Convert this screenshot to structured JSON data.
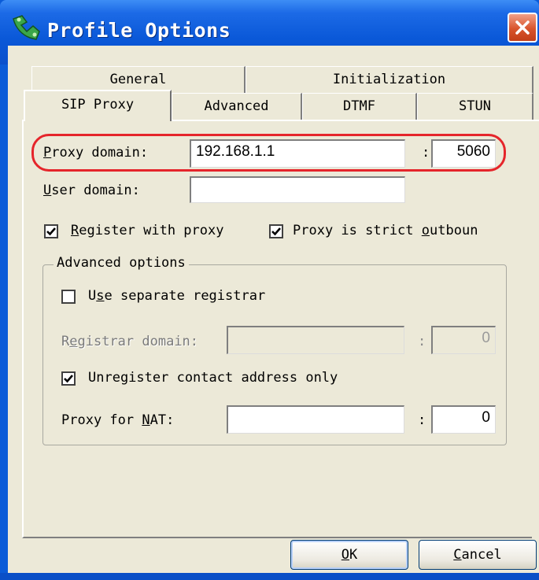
{
  "window": {
    "title": "Profile Options"
  },
  "tabs": {
    "row_top": [
      "General",
      "Initialization"
    ],
    "row_bottom": [
      "SIP Proxy",
      "Advanced",
      "DTMF",
      "STUN"
    ]
  },
  "sip_proxy": {
    "proxy_domain": {
      "label_key": "P",
      "label_rest": "roxy domain:",
      "host": "192.168.1.1",
      "colon": ":",
      "port": "5060"
    },
    "user_domain": {
      "label_key": "U",
      "label_rest": "ser domain:",
      "value": ""
    },
    "register_with_proxy": {
      "label_key": "R",
      "label_rest": "egister with proxy",
      "checked": true
    },
    "proxy_strict_outbound": {
      "label_pre": "Proxy is strict ",
      "label_key": "o",
      "label_rest": "utboun",
      "checked": true
    },
    "advanced_options": {
      "legend": "Advanced options",
      "use_separate_registrar": {
        "label_pre": "U",
        "label_key": "s",
        "label_rest": "e separate registrar",
        "checked": false
      },
      "registrar_domain": {
        "label_pre": "R",
        "label_key": "e",
        "label_rest": "gistrar domain:",
        "host": "",
        "colon": ":",
        "port": "0"
      },
      "unregister_contact_only": {
        "label": "Unregister contact address only",
        "checked": true
      },
      "proxy_for_nat": {
        "label_pre": "Proxy for ",
        "label_key": "N",
        "label_rest": "AT:",
        "host": "",
        "colon": ":",
        "port": "0"
      }
    }
  },
  "buttons": {
    "ok": {
      "key": "O",
      "rest": "K"
    },
    "cancel": {
      "key": "C",
      "rest": "ancel"
    }
  },
  "colors": {
    "titlebar": "#0a58d8",
    "face": "#ece9d8",
    "highlight": "#e5252b",
    "close": "#d8542c"
  },
  "icons": {
    "app": "phone-app-icon",
    "close": "close-x-icon",
    "check": "checkmark-icon"
  }
}
